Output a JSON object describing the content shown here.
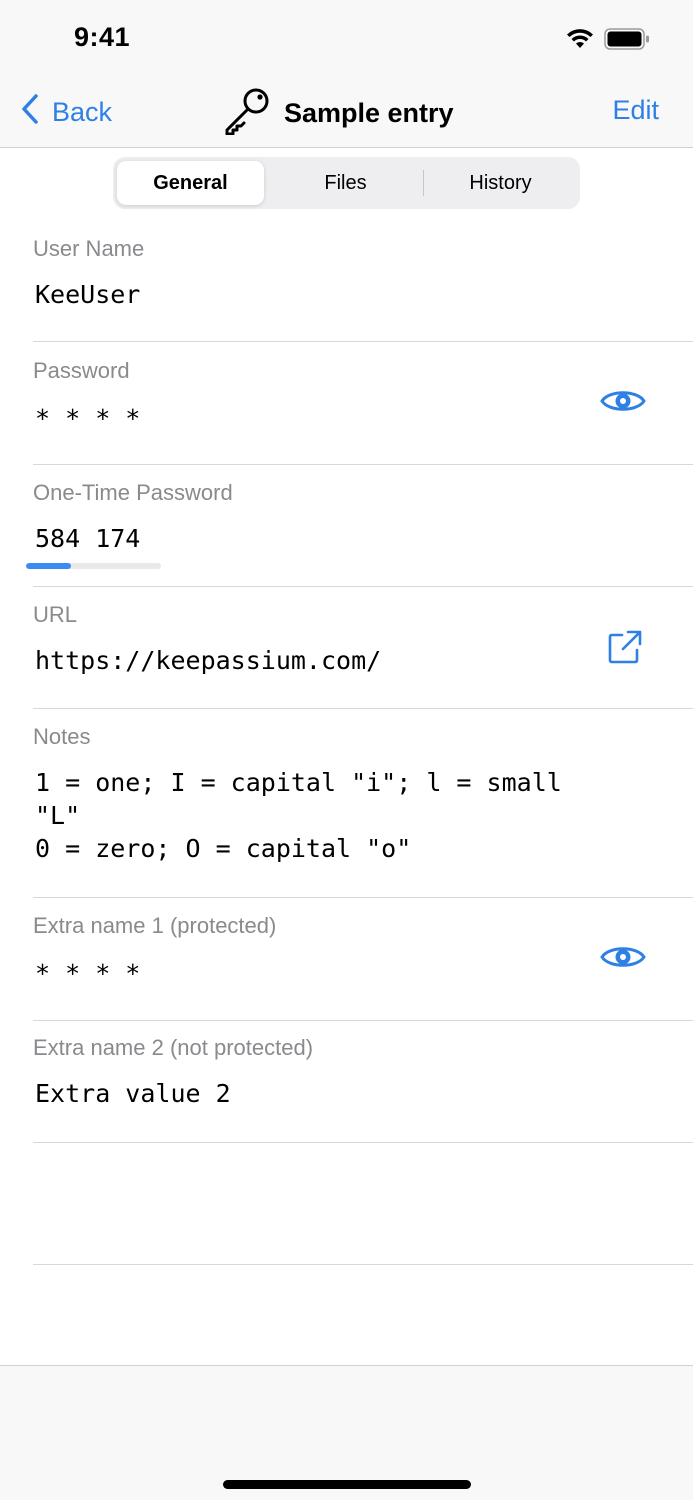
{
  "status_bar": {
    "time": "9:41"
  },
  "nav": {
    "back_label": "Back",
    "title": "Sample entry",
    "edit_label": "Edit"
  },
  "tabs": [
    {
      "label": "General",
      "selected": true
    },
    {
      "label": "Files",
      "selected": false
    },
    {
      "label": "History",
      "selected": false
    }
  ],
  "fields": {
    "username": {
      "label": "User Name",
      "value": "KeeUser"
    },
    "password": {
      "label": "Password",
      "value": "* * * *",
      "icon": "eye-icon"
    },
    "otp": {
      "label": "One-Time Password",
      "value": "584 174",
      "progress": 0.33
    },
    "url": {
      "label": "URL",
      "value": "https://keepassium.com/",
      "icon": "external-link-icon"
    },
    "notes": {
      "label": "Notes",
      "line1": "1 = one; I = capital \"i\"; l = small",
      "line2": "\"L\"",
      "line3": "0 = zero; O = capital \"o\""
    },
    "extra1": {
      "label": "Extra name 1 (protected)",
      "value": "* * * *",
      "icon": "eye-icon"
    },
    "extra2": {
      "label": "Extra name 2 (not protected)",
      "value": "Extra value 2"
    }
  },
  "colors": {
    "accent": "#2f80e4",
    "label": "#8a8a8e",
    "separator": "#d8d8dc",
    "otp_bar": "#3b8cf2"
  }
}
